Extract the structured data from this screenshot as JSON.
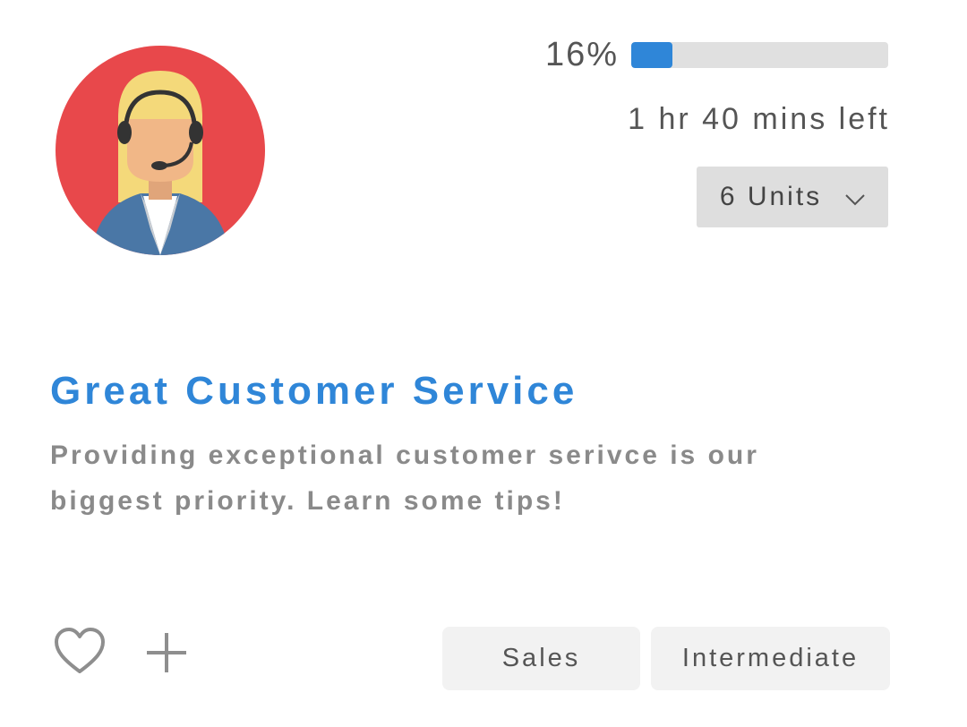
{
  "course": {
    "title": "Great Customer Service",
    "description": "Providing exceptional customer serivce is our biggest priority. Learn some tips!",
    "avatar_icon": "customer-support-agent-icon"
  },
  "progress": {
    "percent_label": "16%",
    "fraction": 0.16,
    "time_left": "1 hr 40 mins left",
    "bar_color": "#2f86d8"
  },
  "units": {
    "selected": "6 Units",
    "icon": "chevron-down-icon"
  },
  "actions": {
    "favorite_icon": "heart-icon",
    "add_icon": "plus-icon"
  },
  "tags": [
    {
      "label": "Sales"
    },
    {
      "label": "Intermediate"
    }
  ],
  "colors": {
    "accent": "#2f86d8",
    "avatar_bg": "#e8484b"
  }
}
